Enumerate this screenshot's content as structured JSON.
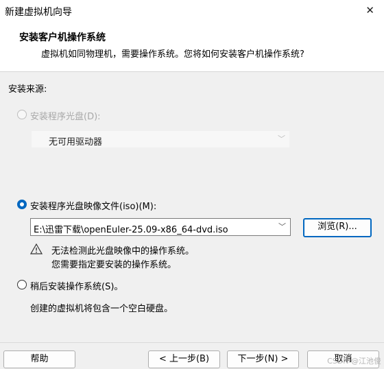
{
  "window": {
    "title": "新建虚拟机向导",
    "close_glyph": "✕"
  },
  "header": {
    "title": "安装客户机操作系统",
    "subtitle": "虚拟机如同物理机，需要操作系统。您将如何安装客户机操作系统?"
  },
  "source_label": "安装来源:",
  "option_disc": {
    "label": "安装程序光盘(D):",
    "selected": false,
    "enabled": false,
    "drive_value": "无可用驱动器",
    "dropdown_icon": "chevron-down-icon"
  },
  "option_iso": {
    "label": "安装程序光盘映像文件(iso)(M):",
    "selected": true,
    "path_value": "E:\\迅雷下载\\openEuler-25.09-x86_64-dvd.iso",
    "browse_label": "浏览(R)...",
    "warning_line1": "无法检测此光盘映像中的操作系统。",
    "warning_line2": "您需要指定要安装的操作系统。",
    "warning_icon": "warning-icon"
  },
  "option_later": {
    "label": "稍后安装操作系统(S)。",
    "selected": false,
    "description": "创建的虚拟机将包含一个空白硬盘。"
  },
  "footer": {
    "help": "帮助",
    "back": "< 上一步(B)",
    "next": "下一步(N) >",
    "cancel": "取消"
  },
  "watermark": "CSDN @江池俊",
  "colors": {
    "accent": "#0067c0",
    "background": "#f0f0f0",
    "header_bg": "#ffffff"
  }
}
